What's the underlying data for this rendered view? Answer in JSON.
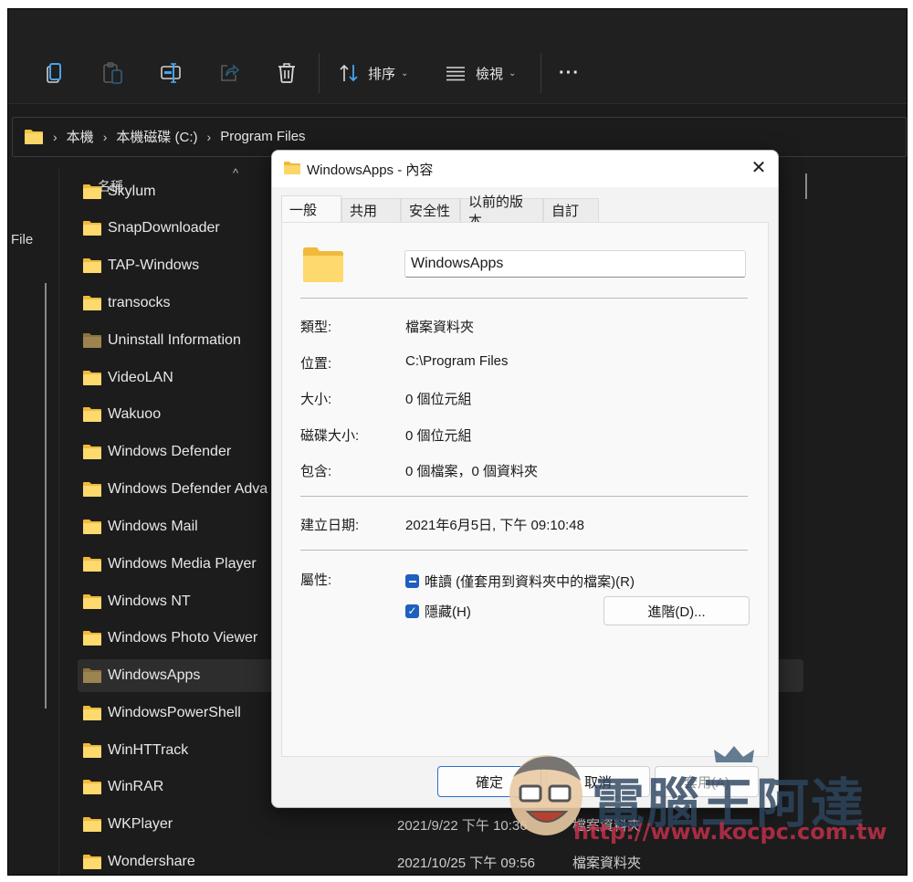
{
  "toolbar": {
    "icons": [
      "copy-icon",
      "paste-icon",
      "rename-icon",
      "share-icon",
      "delete-icon"
    ],
    "sort_label": "排序",
    "view_label": "檢視",
    "more_label": "···"
  },
  "address": {
    "crumbs": [
      "本機",
      "本機磁碟 (C:)",
      "Program Files"
    ]
  },
  "navpane": {
    "truncated_label": "File"
  },
  "list": {
    "column_name": "名稱",
    "items": [
      {
        "name": "Skylum",
        "dim": false
      },
      {
        "name": "SnapDownloader",
        "dim": false
      },
      {
        "name": "TAP-Windows",
        "dim": false
      },
      {
        "name": "transocks",
        "dim": false
      },
      {
        "name": "Uninstall Information",
        "dim": true
      },
      {
        "name": "VideoLAN",
        "dim": false
      },
      {
        "name": "Wakuoo",
        "dim": false
      },
      {
        "name": "Windows Defender",
        "dim": false
      },
      {
        "name": "Windows Defender Adva",
        "dim": false
      },
      {
        "name": "Windows Mail",
        "dim": false
      },
      {
        "name": "Windows Media Player",
        "dim": false
      },
      {
        "name": "Windows NT",
        "dim": false
      },
      {
        "name": "Windows Photo Viewer",
        "dim": false
      },
      {
        "name": "WindowsApps",
        "dim": true,
        "selected": true
      },
      {
        "name": "WindowsPowerShell",
        "dim": false
      },
      {
        "name": "WinHTTrack",
        "dim": false
      },
      {
        "name": "WinRAR",
        "dim": false
      },
      {
        "name": "WKPlayer",
        "dim": false,
        "date": "2021/9/22 下午 10:36",
        "type": "檔案資料夾"
      },
      {
        "name": "Wondershare",
        "dim": false,
        "date": "2021/10/25 下午 09:56",
        "type": "檔案資料夾"
      }
    ]
  },
  "dialog": {
    "title": "WindowsApps - 內容",
    "close_icon": "✕",
    "tabs": [
      "一般",
      "共用",
      "安全性",
      "以前的版本",
      "自訂"
    ],
    "active_tab": 0,
    "name_value": "WindowsApps",
    "props": [
      {
        "label": "類型:",
        "value": "檔案資料夾"
      },
      {
        "label": "位置:",
        "value": "C:\\Program Files"
      },
      {
        "label": "大小:",
        "value": "0 個位元組"
      },
      {
        "label": "磁碟大小:",
        "value": "0 個位元組"
      },
      {
        "label": "包含:",
        "value": "0 個檔案，0 個資料夾"
      }
    ],
    "created_label": "建立日期:",
    "created_value": "2021年6月5日, 下午 09:10:48",
    "attributes_label": "屬性:",
    "readonly_label": "唯讀 (僅套用到資料夾中的檔案)(R)",
    "readonly_state": "indeterminate",
    "hidden_label": "隱藏(H)",
    "hidden_state": "checked",
    "advanced_label": "進階(D)...",
    "ok_label": "確定",
    "cancel_label": "取消",
    "apply_label": "套用(A)"
  },
  "watermark": {
    "title": "電腦王阿達",
    "url": "http://www.kocpc.com.tw"
  }
}
